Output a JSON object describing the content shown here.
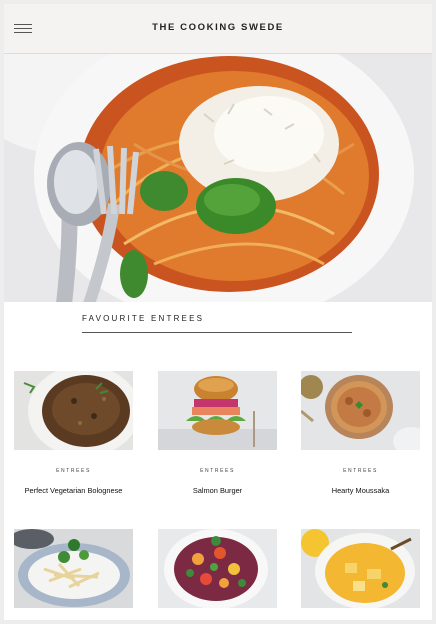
{
  "header": {
    "title": "THE COOKING SWEDE",
    "menu_icon": "hamburger-menu-icon"
  },
  "hero": {
    "image": "spaghetti-with-basil-and-parmesan"
  },
  "section": {
    "heading": "FAVOURITE ENTREES"
  },
  "recipes": [
    {
      "category": "ENTREES",
      "name": "Perfect Vegetarian Bolognese"
    },
    {
      "category": "ENTREES",
      "name": "Salmon Burger"
    },
    {
      "category": "ENTREES",
      "name": "Hearty Moussaka"
    }
  ],
  "second_row": {
    "images": [
      "pasta-with-herbs",
      "vegetable-salad",
      "yellow-curry"
    ]
  }
}
